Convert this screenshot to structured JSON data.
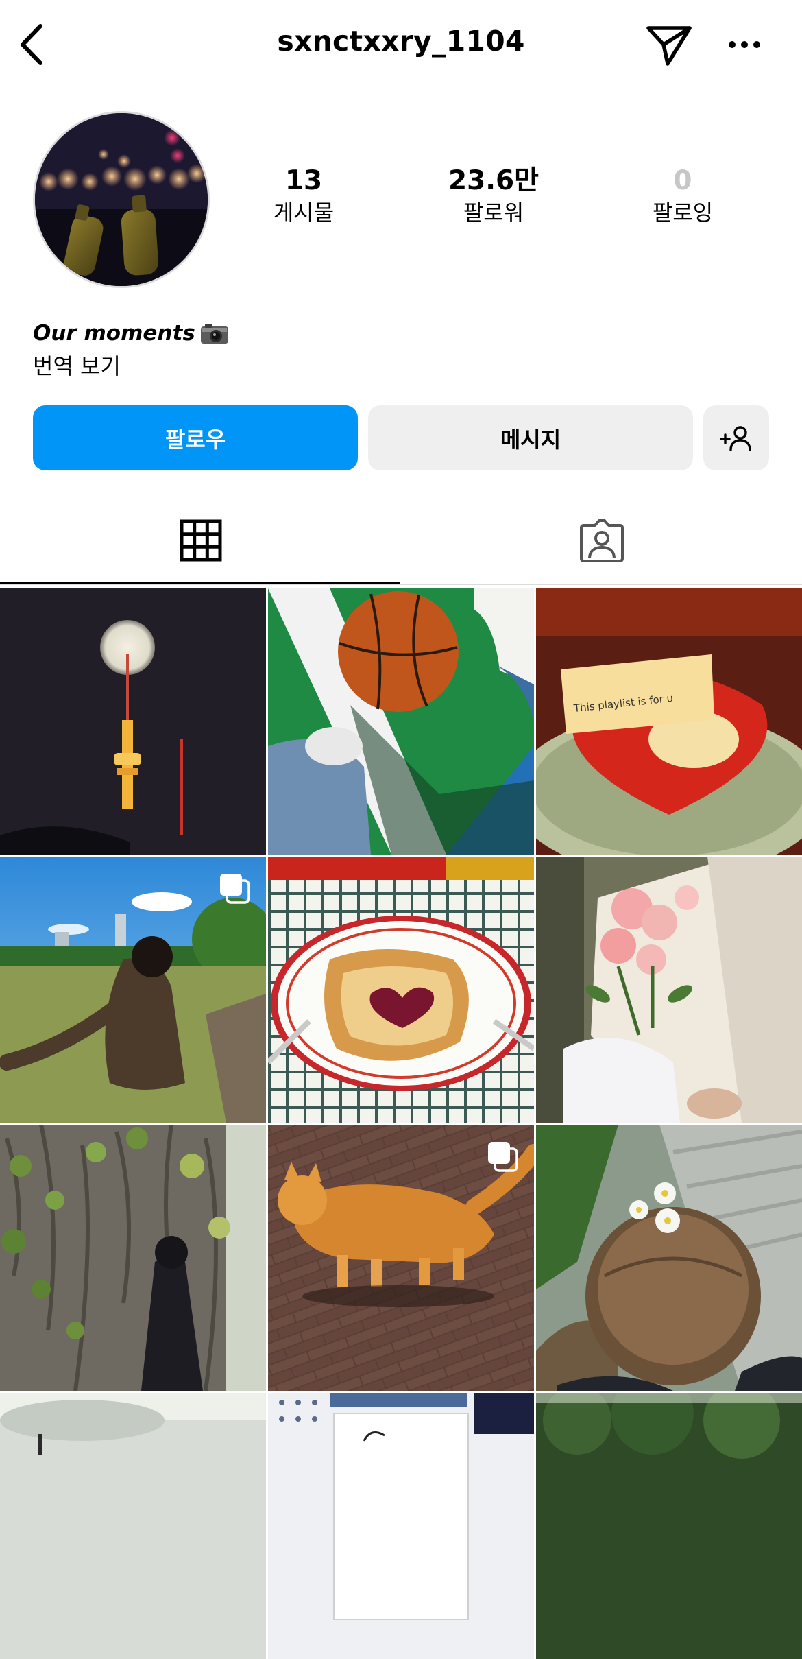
{
  "header": {
    "username": "sxnctxxry_1104"
  },
  "stats": {
    "posts": {
      "value": "13",
      "label": "게시물"
    },
    "followers": {
      "value": "23.6만",
      "label": "팔로워"
    },
    "following": {
      "value": "0",
      "label": "팔로잉"
    }
  },
  "bio": {
    "text": "Our moments",
    "emoji": "camera",
    "translate_label": "번역 보기"
  },
  "actions": {
    "follow_label": "팔로우",
    "message_label": "메시지"
  },
  "tabs": [
    {
      "name": "posts-grid",
      "icon": "grid-icon",
      "selected": true
    },
    {
      "name": "tagged",
      "icon": "tagged-person-icon",
      "selected": false
    }
  ],
  "colors": {
    "accent": "#0095f6",
    "secondary_button": "#efefef",
    "muted_text": "#c7c7c7"
  },
  "posts": [
    {
      "subject": "Namsan tower at night with full moon",
      "multi": false
    },
    {
      "subject": "Basketball on green court",
      "multi": false
    },
    {
      "subject": "Red vinyl record with playlist note",
      "multi": false
    },
    {
      "subject": "Person in field under blue sky",
      "multi": true
    },
    {
      "subject": "Toast with heart jam on plate",
      "multi": false
    },
    {
      "subject": "Pink flower bouquet",
      "multi": false
    },
    {
      "subject": "Person by ivy covered wall",
      "multi": false
    },
    {
      "subject": "Orange cat on brick pavement",
      "multi": true
    },
    {
      "subject": "Daisies in hair on stairs",
      "multi": false
    },
    {
      "subject": "Partial photo",
      "multi": false
    },
    {
      "subject": "Partial photo",
      "multi": false
    },
    {
      "subject": "Partial photo",
      "multi": false
    }
  ]
}
